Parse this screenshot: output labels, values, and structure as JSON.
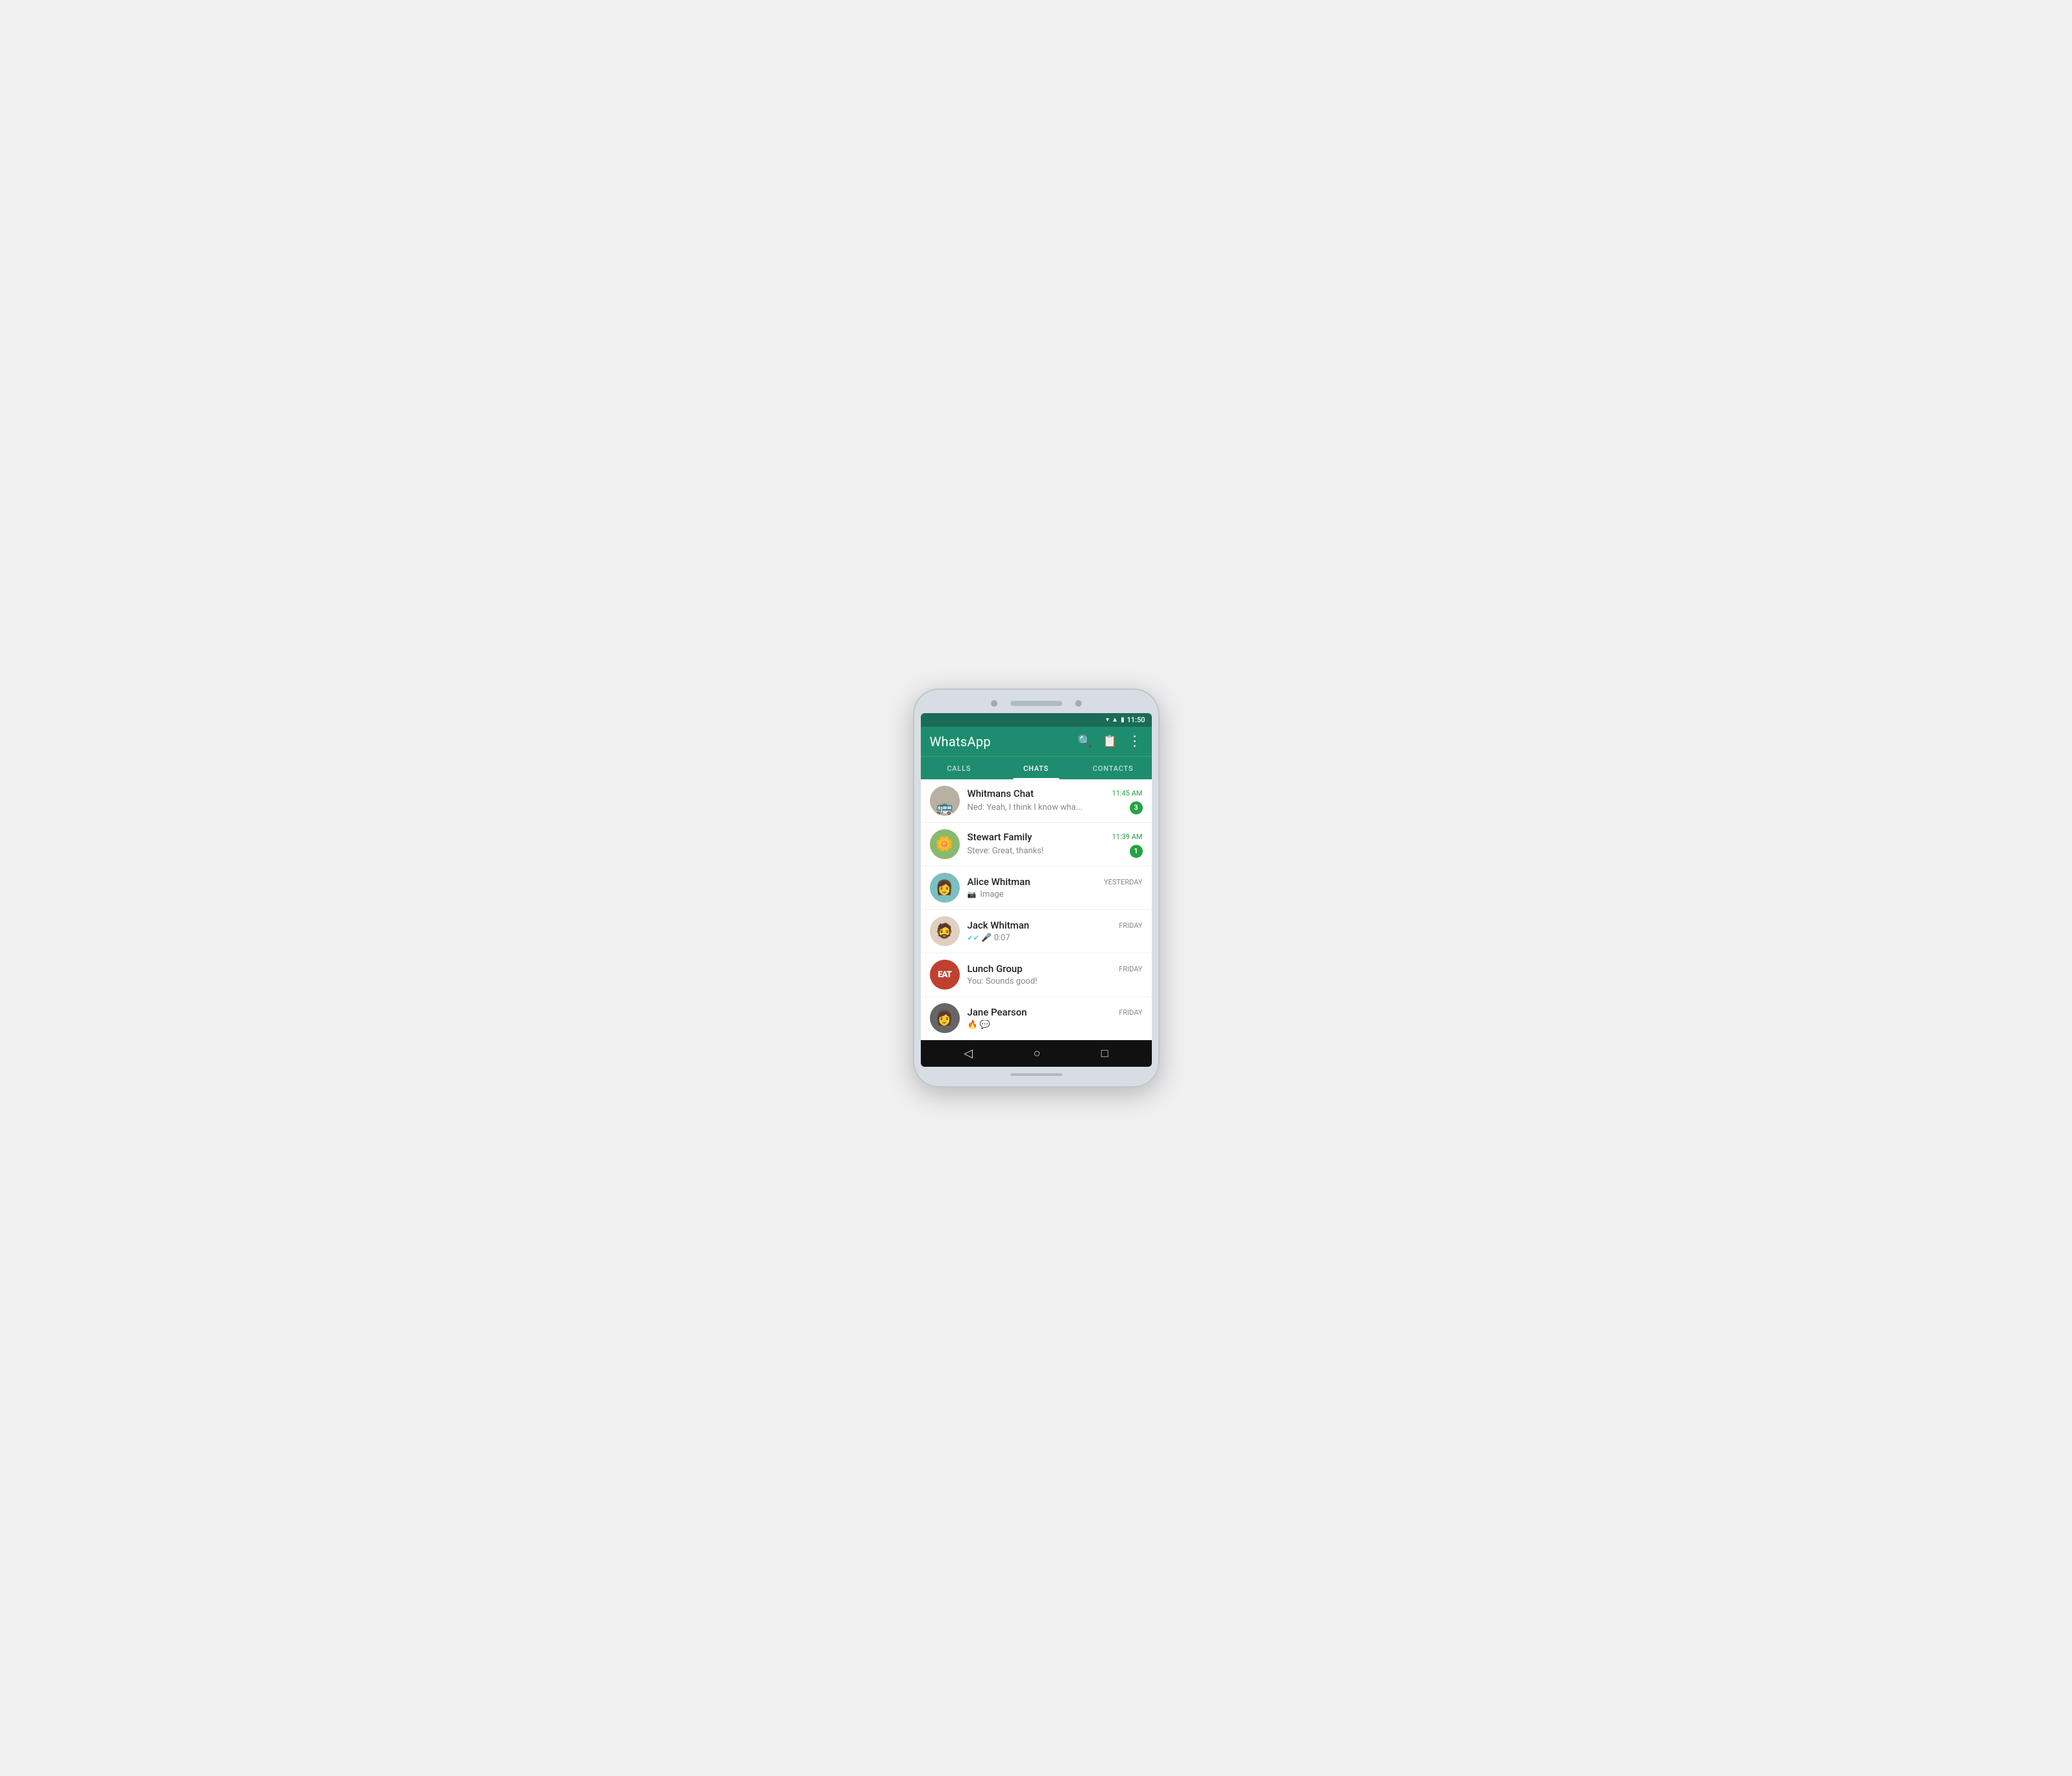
{
  "app": {
    "title": "WhatsApp",
    "status_time": "11:50"
  },
  "tabs": {
    "calls": "CALLS",
    "chats": "CHATS",
    "contacts": "CONTACTS",
    "active": "CHATS"
  },
  "chats": [
    {
      "id": "whitmans",
      "name": "Whitmans Chat",
      "preview": "Ned: Yeah, I think I know wha...",
      "time": "11:45 AM",
      "time_green": true,
      "unread": "3",
      "avatar_label": "🚌"
    },
    {
      "id": "stewart",
      "name": "Stewart Family",
      "preview": "Steve: Great, thanks!",
      "time": "11:39 AM",
      "time_green": true,
      "unread": "1",
      "avatar_label": "🌼"
    },
    {
      "id": "alice",
      "name": "Alice Whitman",
      "preview": "📷 Image",
      "time": "YESTERDAY",
      "time_green": false,
      "unread": "",
      "avatar_label": "👩"
    },
    {
      "id": "jack",
      "name": "Jack Whitman",
      "preview": "✔✔ 🎤 0:07",
      "time": "FRIDAY",
      "time_green": false,
      "unread": "",
      "avatar_label": "🧔"
    },
    {
      "id": "lunch",
      "name": "Lunch Group",
      "preview": "You: Sounds good!",
      "time": "FRIDAY",
      "time_green": false,
      "unread": "",
      "avatar_label": "EAT"
    },
    {
      "id": "jane",
      "name": "Jane Pearson",
      "preview": "🔥 💬",
      "time": "FRIDAY",
      "time_green": false,
      "unread": "",
      "avatar_label": "👩‍🦱"
    }
  ],
  "bottom_nav": {
    "back": "◁",
    "home": "○",
    "recent": "□"
  },
  "icons": {
    "search": "🔍",
    "compose": "📋",
    "menu": "⋮",
    "wifi": "▾",
    "signal": "▲",
    "battery": "▮"
  }
}
